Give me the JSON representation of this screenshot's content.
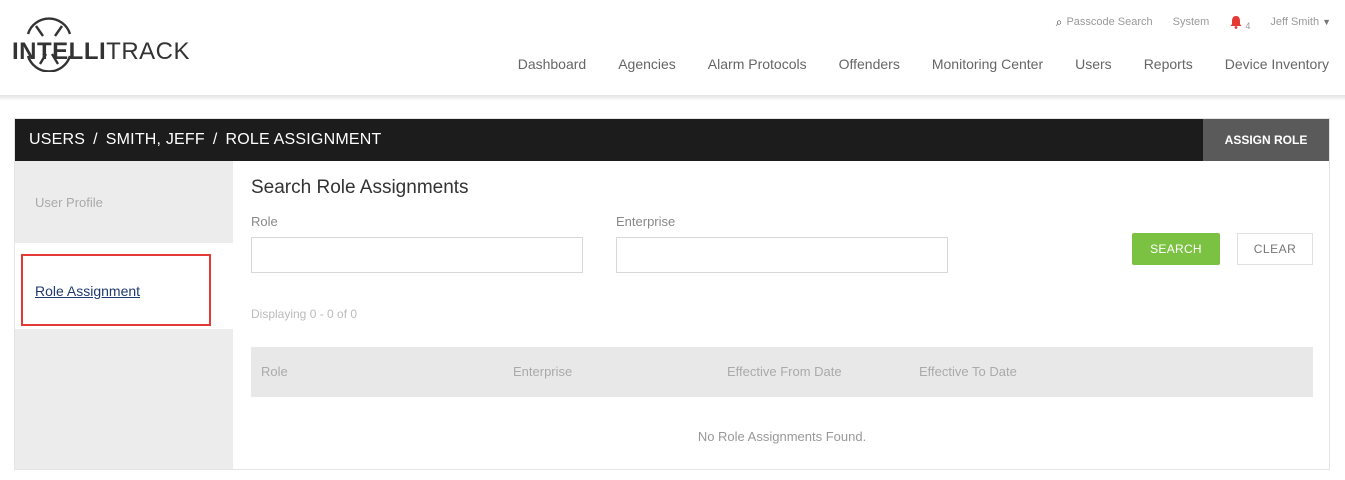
{
  "header": {
    "logo": {
      "text_bold": "INTELLI",
      "text_light": "TRACK"
    },
    "utility": {
      "passcode_search": "Passcode Search",
      "system": "System",
      "notification_count": "4",
      "user_name": "Jeff Smith"
    },
    "nav": [
      "Dashboard",
      "Agencies",
      "Alarm Protocols",
      "Offenders",
      "Monitoring Center",
      "Users",
      "Reports",
      "Device Inventory"
    ]
  },
  "titlebar": {
    "crumbs": [
      "USERS",
      "SMITH, JEFF",
      "ROLE ASSIGNMENT"
    ],
    "separator": "/",
    "assign_role_label": "ASSIGN ROLE"
  },
  "sidebar": {
    "items": [
      {
        "label": "User Profile"
      },
      {
        "label": "Role Assignment"
      }
    ]
  },
  "search": {
    "heading": "Search Role Assignments",
    "role_label": "Role",
    "role_value": "",
    "enterprise_label": "Enterprise",
    "enterprise_value": "",
    "search_label": "SEARCH",
    "clear_label": "CLEAR"
  },
  "results": {
    "displaying": "Displaying 0 - 0 of 0",
    "columns": [
      "Role",
      "Enterprise",
      "Effective From Date",
      "Effective To Date"
    ],
    "empty_message": "No Role Assignments Found."
  },
  "colors": {
    "titlebar": "#1c1c1c",
    "search_button": "#7cc242",
    "alert": "#e53935",
    "link": "#1f3a70"
  }
}
